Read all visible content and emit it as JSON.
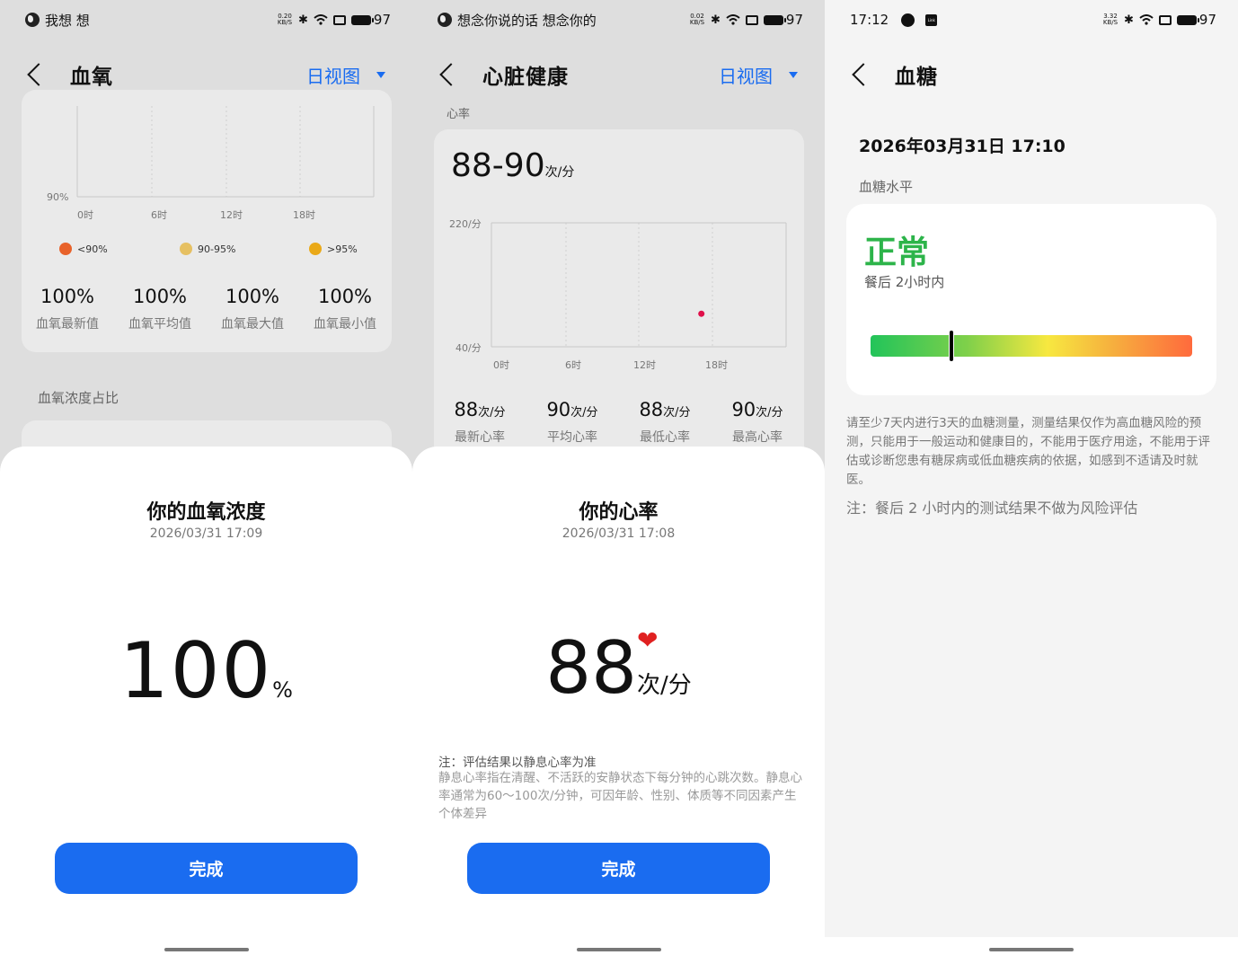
{
  "colors": {
    "accent": "#1a6cf0",
    "normal_green": "#2db44a",
    "heart_red": "#e02020"
  },
  "panel1": {
    "status": {
      "left_text": "我想 想",
      "netspeed_top": "0.20",
      "netspeed_bottom": "KB/S",
      "battery": "97"
    },
    "header": {
      "title": "血氧",
      "view": "日视图"
    },
    "chart": {
      "y_label": "90%",
      "x_ticks": [
        "0时",
        "6时",
        "12时",
        "18时"
      ]
    },
    "legend": [
      {
        "label": "<90%",
        "color": "#e8622a"
      },
      {
        "label": "90-95%",
        "color": "#e6c062"
      },
      {
        "label": ">95%",
        "color": "#eaa918"
      }
    ],
    "stats": [
      {
        "value": "100%",
        "label": "血氧最新值"
      },
      {
        "value": "100%",
        "label": "血氧平均值"
      },
      {
        "value": "100%",
        "label": "血氧最大值"
      },
      {
        "value": "100%",
        "label": "血氧最小值"
      }
    ],
    "section": "血氧浓度占比",
    "sheet": {
      "title": "你的血氧浓度",
      "time": "2026/03/31 17:09",
      "value": "100",
      "unit": "%",
      "button": "完成"
    }
  },
  "panel2": {
    "status": {
      "left_text": "想念你说的话 想念你的",
      "netspeed_top": "0.02",
      "netspeed_bottom": "KB/S",
      "battery": "97"
    },
    "header": {
      "title": "心脏健康",
      "view": "日视图"
    },
    "section": "心率",
    "range": {
      "value": "88-90",
      "unit": "次/分"
    },
    "chart": {
      "y_top": "220/分",
      "y_bottom": "40/分",
      "x_ticks": [
        "0时",
        "6时",
        "12时",
        "18时"
      ]
    },
    "chart_data": {
      "type": "scatter",
      "x_ticks": [
        "0时",
        "6时",
        "12时",
        "18时"
      ],
      "ylim": [
        40,
        220
      ],
      "points": [
        {
          "hour": 17.1,
          "bpm": 88
        }
      ]
    },
    "stats": [
      {
        "value": "88",
        "unit": "次/分",
        "label": "最新心率"
      },
      {
        "value": "90",
        "unit": "次/分",
        "label": "平均心率"
      },
      {
        "value": "88",
        "unit": "次/分",
        "label": "最低心率"
      },
      {
        "value": "90",
        "unit": "次/分",
        "label": "最高心率"
      }
    ],
    "sheet": {
      "title": "你的心率",
      "time": "2026/03/31 17:08",
      "value": "88",
      "unit": "次/分",
      "note_title": "注：评估结果以静息心率为准",
      "note_body": "静息心率指在清醒、不活跃的安静状态下每分钟的心跳次数。静息心率通常为60～100次/分钟，可因年龄、性别、体质等不同因素产生个体差异",
      "button": "完成"
    }
  },
  "panel3": {
    "status": {
      "time": "17:12",
      "netspeed_top": "3.32",
      "netspeed_bottom": "KB/S",
      "battery": "97",
      "link_badge": "Link"
    },
    "header": {
      "title": "血糖"
    },
    "date": "2026年03月31日 17:10",
    "section": "血糖水平",
    "result": "正常",
    "subtitle": "餐后 2小时内",
    "gauge_fraction": 0.25,
    "note": "请至少7天内进行3天的血糖测量，测量结果仅作为高血糖风险的预测，只能用于一般运动和健康目的，不能用于医疗用途，不能用于评估或诊断您患有糖尿病或低血糖疾病的依据，如感到不适请及时就医。",
    "note2": "注：餐后 2 小时内的测试结果不做为风险评估"
  }
}
